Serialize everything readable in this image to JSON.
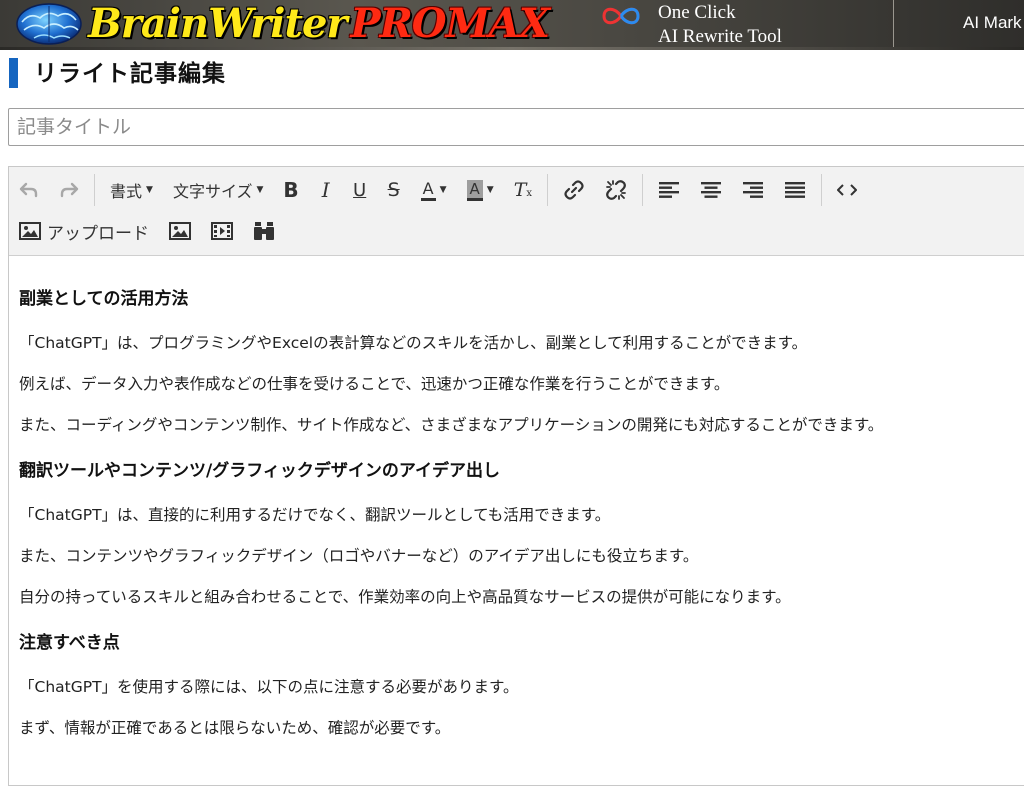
{
  "header": {
    "brand_main": "BrainWriter",
    "brand_pro": "PROMAX",
    "tagline_line1": "One Click",
    "tagline_line2": "AI Rewrite Tool",
    "nav_item": "AI Mark"
  },
  "page": {
    "title": "リライト記事編集"
  },
  "article_title": {
    "placeholder": "記事タイトル",
    "value": ""
  },
  "toolbar": {
    "format_label": "書式",
    "font_size_label": "文字サイズ",
    "upload_label": "アップロード",
    "icons": [
      "undo-icon",
      "redo-icon",
      "bold-icon",
      "italic-icon",
      "underline-icon",
      "strikethrough-icon",
      "text-color-icon",
      "highlight-color-icon",
      "clear-format-icon",
      "link-icon",
      "unlink-icon",
      "align-left-icon",
      "align-center-icon",
      "align-right-icon",
      "align-justify-icon",
      "code-view-icon",
      "upload-image-icon",
      "image-icon",
      "video-icon",
      "binoculars-icon"
    ]
  },
  "content": {
    "sections": [
      {
        "heading": "副業としての活用方法",
        "paragraphs": [
          "「ChatGPT」は、プログラミングやExcelの表計算などのスキルを活かし、副業として利用することができます。",
          "例えば、データ入力や表作成などの仕事を受けることで、迅速かつ正確な作業を行うことができます。",
          "また、コーディングやコンテンツ制作、サイト作成など、さまざまなアプリケーションの開発にも対応することができます。"
        ]
      },
      {
        "heading": "翻訳ツールやコンテンツ/グラフィックデザインのアイデア出し",
        "paragraphs": [
          "「ChatGPT」は、直接的に利用するだけでなく、翻訳ツールとしても活用できます。",
          "また、コンテンツやグラフィックデザイン（ロゴやバナーなど）のアイデア出しにも役立ちます。",
          "自分の持っているスキルと組み合わせることで、作業効率の向上や高品質なサービスの提供が可能になります。"
        ]
      },
      {
        "heading": "注意すべき点",
        "paragraphs": [
          "「ChatGPT」を使用する際には、以下の点に注意する必要があります。",
          "まず、情報が正確であるとは限らないため、確認が必要です。"
        ]
      }
    ]
  },
  "colors": {
    "accent": "#1565c0",
    "brand_yellow": "#ffe91a",
    "brand_red": "#ff2a12",
    "toolbar_bg": "#f2f2f2"
  }
}
